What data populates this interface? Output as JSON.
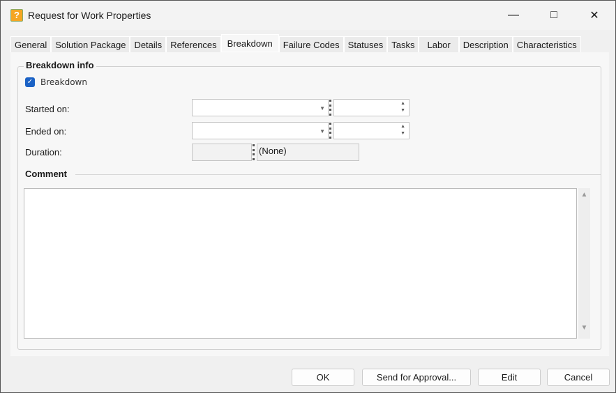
{
  "window": {
    "title": "Request for Work Properties"
  },
  "tabs": [
    "General",
    "Solution Package",
    "Details",
    "References",
    "Breakdown",
    "Failure Codes",
    "Statuses",
    "Tasks",
    "Labor",
    "Description",
    "Characteristics"
  ],
  "active_tab": "Breakdown",
  "breakdown": {
    "group_title": "Breakdown info",
    "checkbox_label": "Breakdown",
    "checked": true,
    "started_label": "Started on:",
    "ended_label": "Ended on:",
    "duration_label": "Duration:",
    "started_date": "",
    "started_time": "",
    "ended_date": "",
    "ended_time": "",
    "duration_value": "",
    "duration_unit": "(None)"
  },
  "comment": {
    "label": "Comment",
    "value": ""
  },
  "buttons": {
    "ok": "OK",
    "send": "Send for Approval...",
    "edit": "Edit",
    "cancel": "Cancel"
  }
}
